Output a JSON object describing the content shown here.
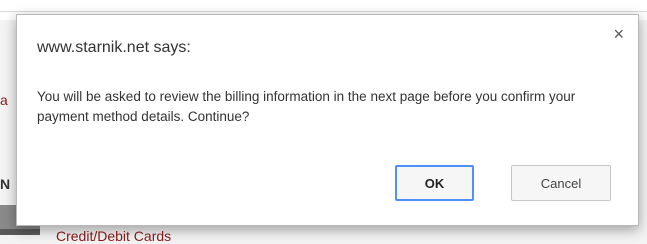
{
  "background": {
    "fragment_a": "a",
    "fragment_b": "N",
    "link_text": "Credit/Debit Cards"
  },
  "dialog": {
    "title": "www.starnik.net says:",
    "close_glyph": "×",
    "message": "You will be asked to review the billing information in the next page before you confirm your payment method details. Continue?",
    "ok_label": "OK",
    "cancel_label": "Cancel"
  },
  "colors": {
    "ok_focus_border": "#4d90fe",
    "link_color": "#8b1a1a"
  },
  "icons": {
    "close": "close-icon",
    "card": "credit-card-icon"
  }
}
